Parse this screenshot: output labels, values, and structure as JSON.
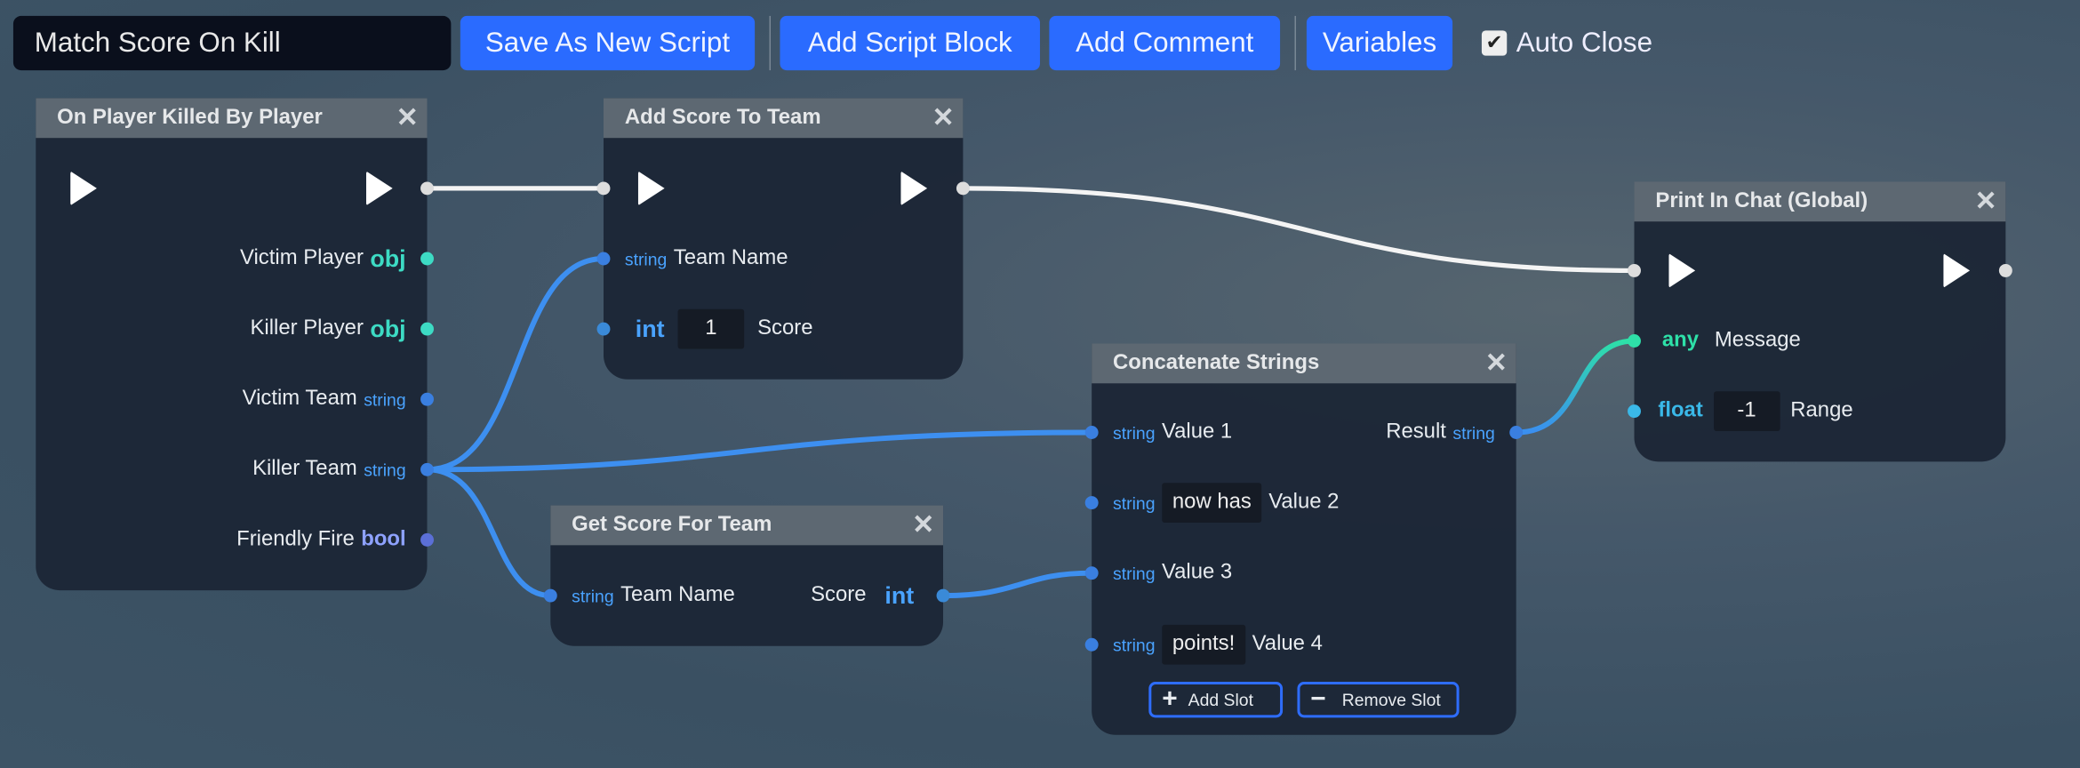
{
  "toolbar": {
    "script_name": "Match Score On Kill",
    "save_as_new": "Save As New Script",
    "add_script_block": "Add Script Block",
    "add_comment": "Add Comment",
    "variables": "Variables",
    "auto_close_label": "Auto Close",
    "auto_close_checked": true,
    "check_glyph": "✔"
  },
  "colors": {
    "button": "#2a6bff",
    "obj": "#3ddbc4",
    "string": "#4aa3ff",
    "int": "#4aa3ff",
    "bool": "#8ea2ff",
    "any": "#2ee0a8",
    "float": "#3ab8e8"
  },
  "nodes": {
    "on_player_killed": {
      "title": "On Player Killed By Player",
      "close": "✕",
      "outputs": [
        {
          "label": "Victim Player",
          "type": "obj"
        },
        {
          "label": "Killer Player",
          "type": "obj"
        },
        {
          "label": "Victim Team",
          "type": "string"
        },
        {
          "label": "Killer Team",
          "type": "string"
        },
        {
          "label": "Friendly Fire",
          "type": "bool"
        }
      ]
    },
    "add_score": {
      "title": "Add Score To Team",
      "close": "✕",
      "inputs": [
        {
          "label": "Team Name",
          "type": "string"
        },
        {
          "label": "Score",
          "type": "int",
          "value": "1"
        }
      ]
    },
    "print_chat": {
      "title": "Print In Chat (Global)",
      "close": "✕",
      "inputs": [
        {
          "label": "Message",
          "type": "any"
        },
        {
          "label": "Range",
          "type": "float",
          "value": "-1"
        }
      ]
    },
    "concat": {
      "title": "Concatenate Strings",
      "close": "✕",
      "inputs": [
        {
          "label": "Value 1",
          "type": "string"
        },
        {
          "label": "Value 2",
          "type": "string",
          "value": "now has"
        },
        {
          "label": "Value 3",
          "type": "string"
        },
        {
          "label": "Value 4",
          "type": "string",
          "value": "points!"
        }
      ],
      "output": {
        "label": "Result",
        "type": "string"
      },
      "add_slot": "Add Slot",
      "remove_slot": "Remove Slot",
      "plus": "+",
      "minus": "−"
    },
    "get_score": {
      "title": "Get Score For Team",
      "close": "✕",
      "input": {
        "label": "Team Name",
        "type": "string"
      },
      "output": {
        "label": "Score",
        "type": "int"
      }
    }
  }
}
